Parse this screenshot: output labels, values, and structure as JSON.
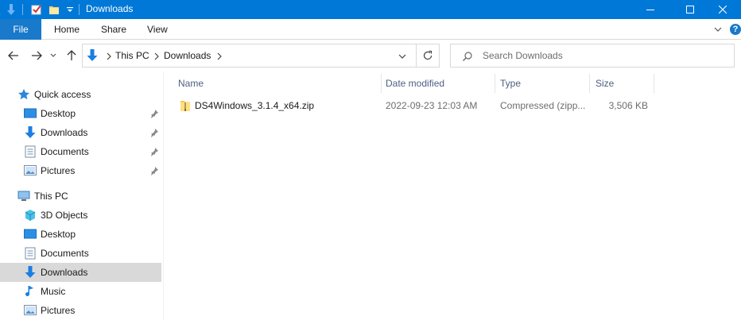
{
  "window": {
    "title": "Downloads",
    "accent_color": "#0078d7",
    "icons": [
      "down-arrow-icon",
      "properties-icon",
      "new-folder-icon",
      "customize-dropdown-icon",
      "minimize-icon",
      "maximize-icon",
      "close-icon"
    ]
  },
  "ribbon": {
    "file_label": "File",
    "tabs": [
      {
        "label": "Home"
      },
      {
        "label": "Share"
      },
      {
        "label": "View"
      }
    ],
    "help_label": "?"
  },
  "address": {
    "crumbs": [
      {
        "label": "This PC"
      },
      {
        "label": "Downloads"
      }
    ]
  },
  "search": {
    "placeholder": "Search Downloads"
  },
  "nav": {
    "quick_access_label": "Quick access",
    "quick_items": [
      {
        "label": "Desktop",
        "icon": "desktop-icon",
        "pinned": true
      },
      {
        "label": "Downloads",
        "icon": "downloads-icon",
        "pinned": true
      },
      {
        "label": "Documents",
        "icon": "documents-icon",
        "pinned": true
      },
      {
        "label": "Pictures",
        "icon": "pictures-icon",
        "pinned": true
      }
    ],
    "this_pc_label": "This PC",
    "pc_items": [
      {
        "label": "3D Objects",
        "icon": "3d-objects-icon"
      },
      {
        "label": "Desktop",
        "icon": "desktop-icon"
      },
      {
        "label": "Documents",
        "icon": "documents-icon"
      },
      {
        "label": "Downloads",
        "icon": "downloads-icon",
        "selected": true
      },
      {
        "label": "Music",
        "icon": "music-icon"
      },
      {
        "label": "Pictures",
        "icon": "pictures-icon"
      }
    ]
  },
  "files": {
    "columns": [
      {
        "label": "Name"
      },
      {
        "label": "Date modified"
      },
      {
        "label": "Type"
      },
      {
        "label": "Size"
      }
    ],
    "rows": [
      {
        "name": "DS4Windows_3.1.4_x64.zip",
        "date": "2022-09-23 12:03 AM",
        "type": "Compressed (zipp...",
        "size": "3,506 KB",
        "icon": "zip-folder-icon"
      }
    ]
  }
}
